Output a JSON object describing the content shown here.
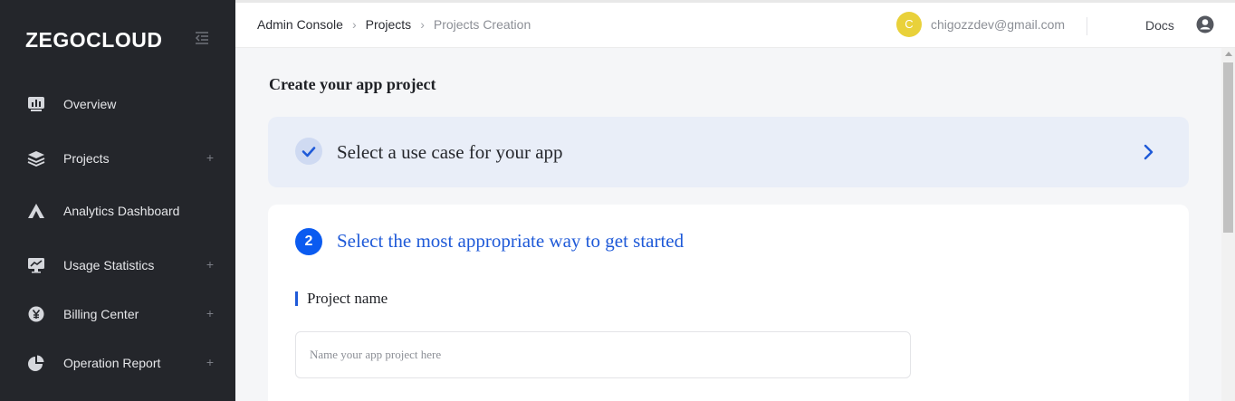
{
  "sidebar": {
    "logo": "ZEGOCLOUD",
    "items": [
      {
        "label": "Overview",
        "icon": "chart-icon",
        "expandable": false
      },
      {
        "label": "Projects",
        "icon": "layers-icon",
        "expandable": true
      },
      {
        "label": "Analytics Dashboard",
        "icon": "triangle-analytics-icon",
        "expandable": false
      },
      {
        "label": "Usage Statistics",
        "icon": "monitor-chart-icon",
        "expandable": true
      },
      {
        "label": "Billing Center",
        "icon": "yen-icon",
        "expandable": true
      },
      {
        "label": "Operation Report",
        "icon": "pie-chart-icon",
        "expandable": true
      }
    ]
  },
  "header": {
    "breadcrumb": [
      "Admin Console",
      "Projects",
      "Projects Creation"
    ],
    "user": {
      "initial": "C",
      "email": "chigozzdev@gmail.com",
      "avatar_color": "#e9d13a"
    },
    "docs_label": "Docs"
  },
  "main": {
    "page_title": "Create your app project",
    "step1": {
      "title": "Select a use case for your app",
      "status": "completed"
    },
    "step2": {
      "number": "2",
      "title": "Select the most appropriate way to get started",
      "status": "active"
    },
    "project_name": {
      "label": "Project name",
      "placeholder": "Name your app project here",
      "value": ""
    }
  },
  "colors": {
    "sidebar_bg": "#24262b",
    "accent": "#0b5bf0",
    "completed_card_bg": "#e9eef8"
  }
}
